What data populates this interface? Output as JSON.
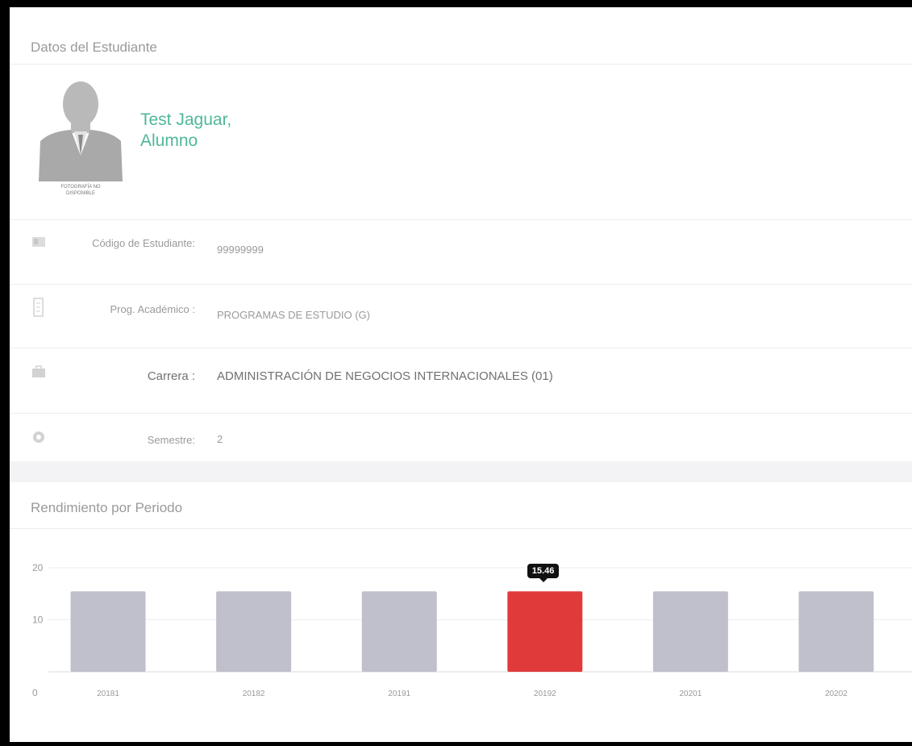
{
  "student_panel": {
    "title": "Datos del Estudiante",
    "avatar_caption": "FOTOGRAFÍA NO DISPONIBLE",
    "name_line1": "Test Jaguar,",
    "name_line2": "Alumno"
  },
  "info_rows": [
    {
      "icon": "id-card-icon",
      "label": "Código de Estudiante:",
      "value": "99999999"
    },
    {
      "icon": "document-icon",
      "label": "Prog. Académico :",
      "value": "PROGRAMAS DE ESTUDIO (G)"
    },
    {
      "icon": "briefcase-icon",
      "label": "Carrera :",
      "value": "ADMINISTRACIÓN DE NEGOCIOS INTERNACIONALES (01)"
    },
    {
      "icon": "gear-icon",
      "label": "Semestre:",
      "value": "2"
    }
  ],
  "performance": {
    "title": "Rendimiento por Periodo"
  },
  "chart_data": {
    "type": "bar",
    "title": "",
    "xlabel": "",
    "ylabel": "",
    "ylim": [
      0,
      20
    ],
    "yticks": [
      0,
      10,
      20
    ],
    "categories": [
      "20181",
      "20182",
      "20191",
      "20192",
      "20201",
      "20202"
    ],
    "values": [
      15.46,
      15.46,
      15.46,
      15.46,
      15.46,
      15.46
    ],
    "highlight_index": 3,
    "tooltip": "15.46",
    "colors": {
      "bar": "#bfc0cc",
      "highlight": "#e03a3a"
    },
    "grid": true
  }
}
